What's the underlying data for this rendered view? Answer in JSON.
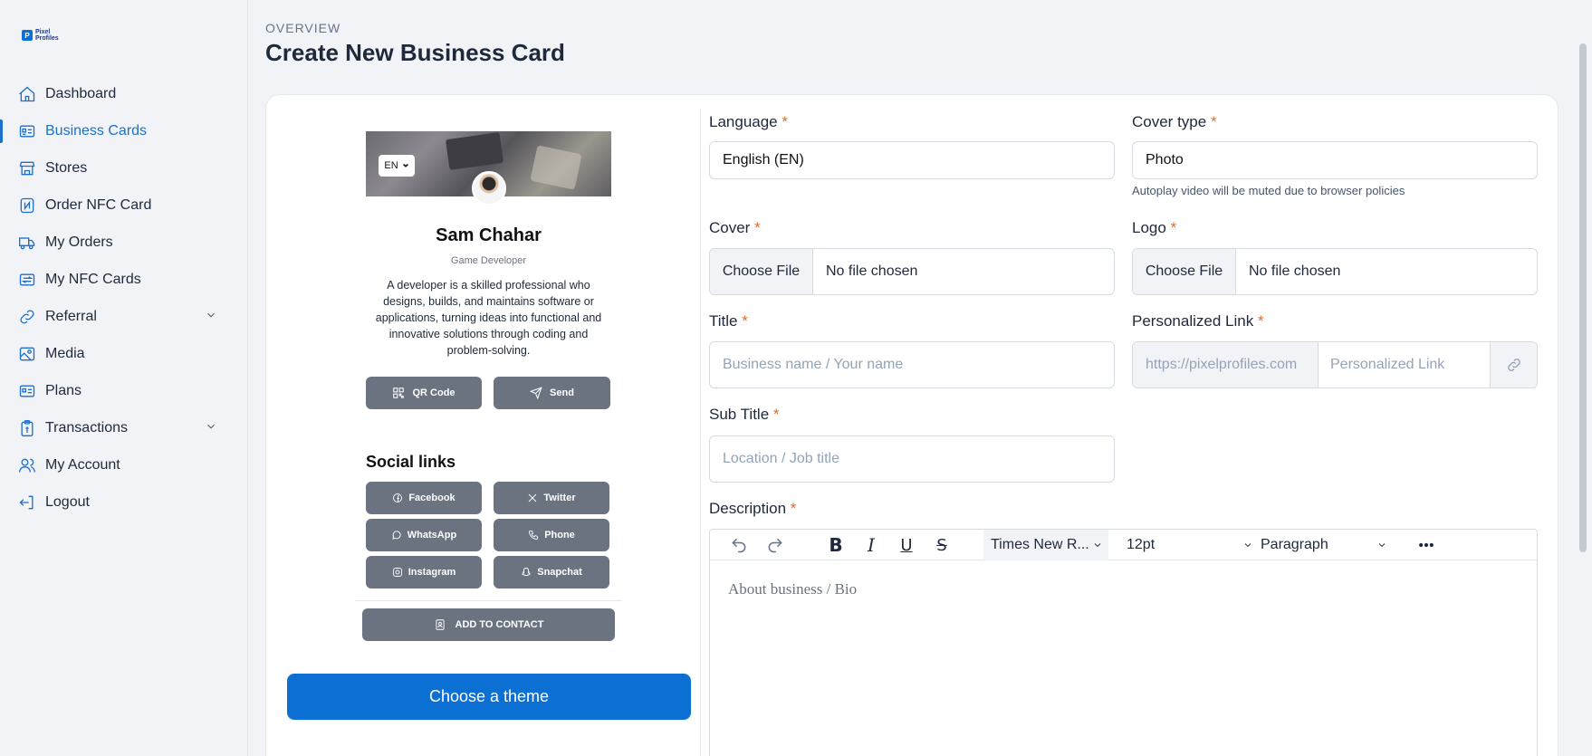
{
  "brand": {
    "logo_text": "Pixel Profiles",
    "logo_mark": "P",
    "accent": "#0b6fd4"
  },
  "sidebar": {
    "items": [
      {
        "label": "Dashboard",
        "icon": "home-icon"
      },
      {
        "label": "Business Cards",
        "icon": "id-card-icon",
        "active": true
      },
      {
        "label": "Stores",
        "icon": "store-icon"
      },
      {
        "label": "Order NFC Card",
        "icon": "nfc-icon"
      },
      {
        "label": "My Orders",
        "icon": "truck-icon"
      },
      {
        "label": "My NFC Cards",
        "icon": "card-transfer-icon"
      },
      {
        "label": "Referral",
        "icon": "link-icon",
        "expandable": true
      },
      {
        "label": "Media",
        "icon": "image-icon"
      },
      {
        "label": "Plans",
        "icon": "plans-icon"
      },
      {
        "label": "Transactions",
        "icon": "clipboard-icon",
        "expandable": true
      },
      {
        "label": "My Account",
        "icon": "users-icon"
      },
      {
        "label": "Logout",
        "icon": "logout-icon"
      }
    ]
  },
  "header": {
    "overline": "OVERVIEW",
    "title": "Create New Business Card"
  },
  "preview": {
    "lang": "EN",
    "name": "Sam Chahar",
    "role": "Game Developer",
    "bio": "A developer is a skilled professional who designs, builds, and maintains software or applications, turning ideas into functional and innovative solutions through coding and problem-solving.",
    "qr_label": "QR Code",
    "send_label": "Send",
    "social_heading": "Social links",
    "social": [
      "Facebook",
      "Twitter",
      "WhatsApp",
      "Phone",
      "Instagram",
      "Snapchat"
    ],
    "add_contact": "ADD TO CONTACT"
  },
  "theme_button": "Choose a theme",
  "form": {
    "language": {
      "label": "Language",
      "value": "English (EN)"
    },
    "cover_type": {
      "label": "Cover type",
      "value": "Photo",
      "hint": "Autoplay video will be muted due to browser policies"
    },
    "cover": {
      "label": "Cover",
      "button": "Choose File",
      "status": "No file chosen"
    },
    "logo": {
      "label": "Logo",
      "button": "Choose File",
      "status": "No file chosen"
    },
    "title": {
      "label": "Title",
      "placeholder": "Business name / Your name"
    },
    "personalized_link": {
      "label": "Personalized Link",
      "prefix": "https://pixelprofiles.com",
      "placeholder": "Personalized Link"
    },
    "subtitle": {
      "label": "Sub Title",
      "placeholder": "Location / Job title"
    },
    "description": {
      "label": "Description",
      "font": "Times New R...",
      "size": "12pt",
      "block": "Paragraph",
      "placeholder": "About business / Bio"
    },
    "required_mark": "*"
  }
}
